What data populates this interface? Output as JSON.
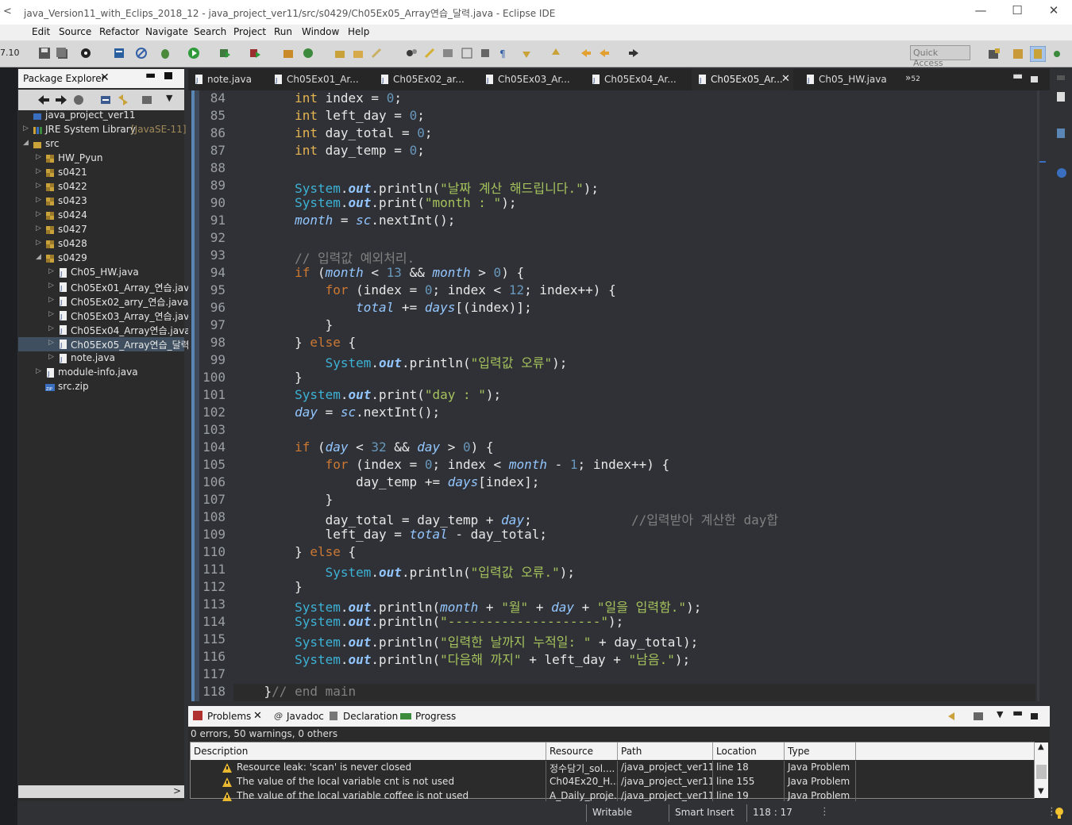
{
  "window": {
    "title": "java_Version11_with_Eclips_2018_12 - java_project_ver11/src/s0429/Ch05Ex05_Array연습_달력.java - Eclipse IDE",
    "minimize": "—",
    "maximize": "☐",
    "close": "✕"
  },
  "menu": [
    "Edit",
    "Source",
    "Refactor",
    "Navigate",
    "Search",
    "Project",
    "Run",
    "Window",
    "Help"
  ],
  "left_stub": "7.10",
  "quick_access": "Quick Access",
  "package_explorer": {
    "title": "Package Explorer",
    "tree": [
      {
        "label": "java_project_ver11",
        "depth": 0,
        "arrow": "",
        "icon": "project"
      },
      {
        "label": "JRE System Library",
        "extra": "[JavaSE-11]",
        "depth": 0,
        "arrow": "▷",
        "icon": "library"
      },
      {
        "label": "src",
        "depth": 0,
        "arrow": "◢",
        "icon": "folder"
      },
      {
        "label": "HW_Pyun",
        "depth": 1,
        "arrow": "▷",
        "icon": "package"
      },
      {
        "label": "s0421",
        "depth": 1,
        "arrow": "▷",
        "icon": "package"
      },
      {
        "label": "s0422",
        "depth": 1,
        "arrow": "▷",
        "icon": "package"
      },
      {
        "label": "s0423",
        "depth": 1,
        "arrow": "▷",
        "icon": "package"
      },
      {
        "label": "s0424",
        "depth": 1,
        "arrow": "▷",
        "icon": "package"
      },
      {
        "label": "s0427",
        "depth": 1,
        "arrow": "▷",
        "icon": "package"
      },
      {
        "label": "s0428",
        "depth": 1,
        "arrow": "▷",
        "icon": "package"
      },
      {
        "label": "s0429",
        "depth": 1,
        "arrow": "◢",
        "icon": "package"
      },
      {
        "label": "Ch05_HW.java",
        "depth": 2,
        "arrow": "▷",
        "icon": "java"
      },
      {
        "label": "Ch05Ex01_Array_연습.jav",
        "depth": 2,
        "arrow": "▷",
        "icon": "java"
      },
      {
        "label": "Ch05Ex02_arry_연습.java",
        "depth": 2,
        "arrow": "▷",
        "icon": "java"
      },
      {
        "label": "Ch05Ex03_Array_연습.jav",
        "depth": 2,
        "arrow": "▷",
        "icon": "java"
      },
      {
        "label": "Ch05Ex04_Array연습.java",
        "depth": 2,
        "arrow": "▷",
        "icon": "java"
      },
      {
        "label": "Ch05Ex05_Array연습_달력",
        "depth": 2,
        "arrow": "▷",
        "icon": "java",
        "selected": true
      },
      {
        "label": "note.java",
        "depth": 2,
        "arrow": "▷",
        "icon": "java"
      },
      {
        "label": "module-info.java",
        "depth": 1,
        "arrow": "▷",
        "icon": "java"
      },
      {
        "label": "src.zip",
        "depth": 1,
        "arrow": "",
        "icon": "zip"
      }
    ]
  },
  "editor_tabs": [
    {
      "label": "note.java"
    },
    {
      "label": "Ch05Ex01_Ar..."
    },
    {
      "label": "Ch05Ex02_ar..."
    },
    {
      "label": "Ch05Ex03_Ar..."
    },
    {
      "label": "Ch05Ex04_Ar..."
    },
    {
      "label": "Ch05Ex05_Ar...",
      "active": true
    },
    {
      "label": "Ch05_HW.java"
    }
  ],
  "overflow_tabs": "»",
  "overflow_count": "52",
  "code": [
    {
      "n": "84",
      "src": "        int index = 0;"
    },
    {
      "n": "85",
      "src": "        int left_day = 0;"
    },
    {
      "n": "86",
      "src": "        int day_total = 0;"
    },
    {
      "n": "87",
      "src": "        int day_temp = 0;"
    },
    {
      "n": "88",
      "src": ""
    },
    {
      "n": "89",
      "src": "        System.out.println(\"날짜 계산 해드립니다.\");"
    },
    {
      "n": "90",
      "src": "        System.out.print(\"month : \");"
    },
    {
      "n": "91",
      "src": "        month = sc.nextInt();"
    },
    {
      "n": "92",
      "src": ""
    },
    {
      "n": "93",
      "src": "        // 입력값 예외처리."
    },
    {
      "n": "94",
      "src": "        if (month < 13 && month > 0) {"
    },
    {
      "n": "95",
      "src": "            for (index = 0; index < 12; index++) {"
    },
    {
      "n": "96",
      "src": "                total += days[(index)];"
    },
    {
      "n": "97",
      "src": "            }"
    },
    {
      "n": "98",
      "src": "        } else {"
    },
    {
      "n": "99",
      "src": "            System.out.println(\"입력값 오류\");"
    },
    {
      "n": "100",
      "src": "        }"
    },
    {
      "n": "101",
      "src": "        System.out.print(\"day : \");"
    },
    {
      "n": "102",
      "src": "        day = sc.nextInt();"
    },
    {
      "n": "103",
      "src": ""
    },
    {
      "n": "104",
      "src": "        if (day < 32 && day > 0) {"
    },
    {
      "n": "105",
      "src": "            for (index = 0; index < month - 1; index++) {"
    },
    {
      "n": "106",
      "src": "                day_temp += days[index];"
    },
    {
      "n": "107",
      "src": "            }"
    },
    {
      "n": "108",
      "src": "            day_total = day_temp + day;             //입력받아 계산한 day합"
    },
    {
      "n": "109",
      "src": "            left_day = total - day_total;"
    },
    {
      "n": "110",
      "src": "        } else {"
    },
    {
      "n": "111",
      "src": "            System.out.println(\"입력값 오류.\");"
    },
    {
      "n": "112",
      "src": "        }"
    },
    {
      "n": "113",
      "src": "        System.out.println(month + \"월\" + day + \"일을 입력함.\");"
    },
    {
      "n": "114",
      "src": "        System.out.println(\"--------------------\");"
    },
    {
      "n": "115",
      "src": "        System.out.println(\"입력한 날까지 누적일: \" + day_total);"
    },
    {
      "n": "116",
      "src": "        System.out.println(\"다음해 까지\" + left_day + \"남음.\");"
    },
    {
      "n": "117",
      "src": ""
    },
    {
      "n": "118",
      "src": "    }// end main"
    }
  ],
  "bottom_panel": {
    "tabs": [
      "Problems",
      "Javadoc",
      "Declaration",
      "Progress"
    ],
    "summary": "0 errors, 50 warnings, 0 others",
    "columns": [
      "Description",
      "Resource",
      "Path",
      "Location",
      "Type"
    ],
    "rows": [
      [
        "Resource leak: 'scan' is never closed",
        "정수담기_sol....",
        "/java_project_ver11...",
        "line 18",
        "Java Problem"
      ],
      [
        "The value of the local variable cnt is not used",
        "Ch04Ex20_H...",
        "/java_project_ver11...",
        "line 155",
        "Java Problem"
      ],
      [
        "The value of the local variable coffee is not used",
        "A_Daily_proje...",
        "/java_project_ver11...",
        "line 19",
        "Java Problem"
      ]
    ]
  },
  "status": {
    "writable": "Writable",
    "insert_mode": "Smart Insert",
    "position": "118 : 17"
  },
  "colors": {
    "editor_bg": "#2f3136",
    "keyword": "#cc7832",
    "string": "#a5c25c",
    "number": "#6897bb",
    "field": "#93c6ff",
    "system": "#3db2d6"
  }
}
